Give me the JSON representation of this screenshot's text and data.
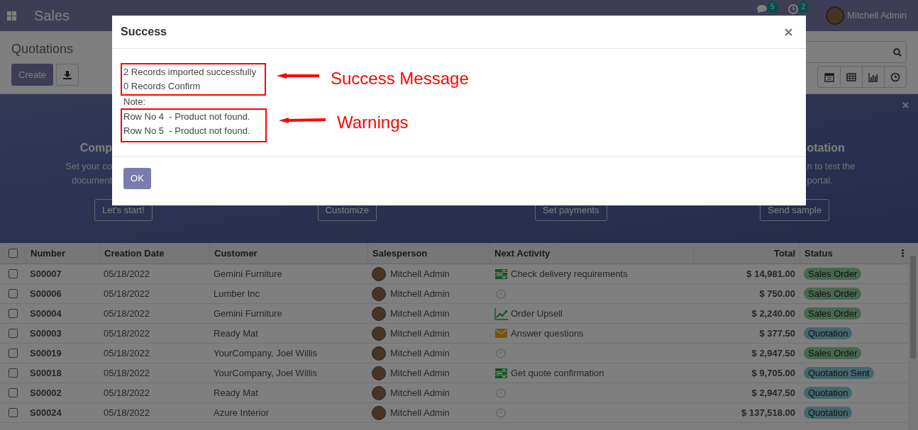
{
  "navbar": {
    "app": "Sales",
    "messages_badge": "5",
    "activities_badge": "2",
    "user": "Mitchell Admin"
  },
  "control_panel": {
    "title": "Quotations",
    "create_button": "Create"
  },
  "banner": {
    "steps": [
      {
        "title": "Comp",
        "text": [
          "Set your co",
          "document"
        ],
        "button": "Let's start!"
      },
      {
        "button": "Customize"
      },
      {
        "button": "Set payments"
      },
      {
        "title": "otation",
        "text": [
          "n to test the",
          "portal."
        ],
        "button": "Send sample"
      }
    ]
  },
  "table": {
    "select_all_checked": false,
    "columns": [
      "Number",
      "Creation Date",
      "Customer",
      "Salesperson",
      "Next Activity",
      "Total",
      "Status"
    ],
    "rows": [
      {
        "number": "S00007",
        "date": "05/18/2022",
        "customer": "Gemini Furniture",
        "salesperson": "Mitchell Admin",
        "activity": {
          "kind": "todo",
          "label": "Check delivery requirements"
        },
        "total": "$ 14,981.00",
        "checked": false,
        "status": {
          "label": "Sales Order",
          "kind": "sales_order"
        }
      },
      {
        "number": "S00006",
        "date": "05/18/2022",
        "customer": "Lumber Inc",
        "salesperson": "Mitchell Admin",
        "activity": {
          "kind": "none"
        },
        "total": "$ 750.00",
        "checked": false,
        "status": {
          "label": "Sales Order",
          "kind": "sales_order"
        }
      },
      {
        "number": "S00004",
        "date": "05/18/2022",
        "customer": "Gemini Furniture",
        "salesperson": "Mitchell Admin",
        "activity": {
          "kind": "upsell",
          "label": "Order Upsell"
        },
        "total": "$ 2,240.00",
        "checked": false,
        "status": {
          "label": "Sales Order",
          "kind": "sales_order"
        }
      },
      {
        "number": "S00003",
        "date": "05/18/2022",
        "customer": "Ready Mat",
        "salesperson": "Mitchell Admin",
        "activity": {
          "kind": "email",
          "label": "Answer questions"
        },
        "total": "$ 377.50",
        "checked": false,
        "status": {
          "label": "Quotation",
          "kind": "quotation"
        }
      },
      {
        "number": "S00019",
        "date": "05/18/2022",
        "customer": "YourCompany, Joel Willis",
        "salesperson": "Mitchell Admin",
        "activity": {
          "kind": "none"
        },
        "total": "$ 2,947.50",
        "checked": false,
        "status": {
          "label": "Sales Order",
          "kind": "sales_order"
        }
      },
      {
        "number": "S00018",
        "date": "05/18/2022",
        "customer": "YourCompany, Joel Willis",
        "salesperson": "Mitchell Admin",
        "activity": {
          "kind": "todo",
          "label": "Get quote confirmation"
        },
        "total": "$ 9,705.00",
        "checked": false,
        "status": {
          "label": "Quotation Sent",
          "kind": "quotation"
        }
      },
      {
        "number": "S00002",
        "date": "05/18/2022",
        "customer": "Ready Mat",
        "salesperson": "Mitchell Admin",
        "activity": {
          "kind": "none"
        },
        "total": "$ 2,947.50",
        "checked": false,
        "status": {
          "label": "Quotation",
          "kind": "quotation"
        }
      },
      {
        "number": "S00024",
        "date": "05/18/2022",
        "customer": "Azure Interior",
        "salesperson": "Mitchell Admin",
        "activity": {
          "kind": "none"
        },
        "total": "$ 137,518.00",
        "checked": false,
        "status": {
          "label": "Quotation",
          "kind": "quotation"
        }
      }
    ]
  },
  "dialog": {
    "title": "Success",
    "messages": [
      "2 Records imported successfully",
      "0 Records Confirm"
    ],
    "note_label": "Note:",
    "warnings": [
      "Row No 4  - Product not found.",
      "Row No 5  - Product not found."
    ],
    "ok_button": "OK"
  },
  "annotations": [
    {
      "label": "Success Message"
    },
    {
      "label": "Warnings"
    }
  ]
}
